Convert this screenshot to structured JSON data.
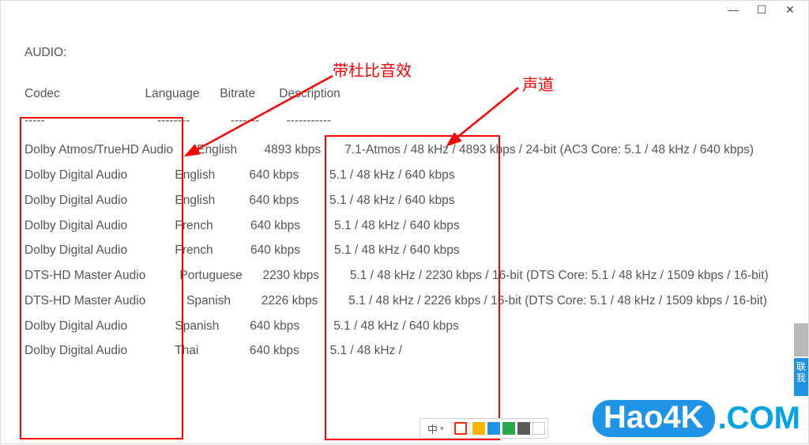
{
  "window": {
    "min_icon": "—",
    "max_icon": "☐",
    "close_icon": "✕"
  },
  "section_title": "AUDIO:",
  "headers": {
    "codec": "Codec",
    "language": "Language",
    "bitrate": "Bitrate",
    "description": "Description"
  },
  "dashes": {
    "codec": "-----",
    "language": "--------",
    "bitrate": "-------",
    "description": "-----------"
  },
  "rows": [
    {
      "codec": "Dolby Atmos/TrueHD Audio",
      "language": "English",
      "bitrate": "4893 kbps",
      "description": "7.1-Atmos / 48 kHz / 4893 kbps / 24-bit (AC3 Core: 5.1 / 48 kHz / 640 kbps)"
    },
    {
      "codec": "Dolby Digital Audio",
      "language": "English",
      "bitrate": "640 kbps",
      "description": "5.1 / 48 kHz / 640 kbps"
    },
    {
      "codec": "Dolby Digital Audio",
      "language": "English",
      "bitrate": "640 kbps",
      "description": "5.1 / 48 kHz / 640 kbps"
    },
    {
      "codec": "Dolby Digital Audio",
      "language": "French",
      "bitrate": "640 kbps",
      "description": "5.1 / 48 kHz / 640 kbps"
    },
    {
      "codec": "Dolby Digital Audio",
      "language": "French",
      "bitrate": "640 kbps",
      "description": "5.1 / 48 kHz / 640 kbps"
    },
    {
      "codec": "DTS-HD Master Audio",
      "language": "Portuguese",
      "bitrate": "2230 kbps",
      "description": "5.1 / 48 kHz / 2230 kbps / 16-bit (DTS Core: 5.1 / 48 kHz / 1509 kbps / 16-bit)"
    },
    {
      "codec": "DTS-HD Master Audio",
      "language": "Spanish",
      "bitrate": "2226 kbps",
      "description": "5.1 / 48 kHz / 2226 kbps / 16-bit (DTS Core: 5.1 / 48 kHz / 1509 kbps / 16-bit)"
    },
    {
      "codec": "Dolby Digital Audio",
      "language": "Spanish",
      "bitrate": "640 kbps",
      "description": "5.1 / 48 kHz / 640 kbps"
    },
    {
      "codec": "Dolby Digital Audio",
      "language": "Thai",
      "bitrate": "640 kbps",
      "description": "5.1 / 48 kHz /"
    }
  ],
  "annotations": {
    "dolby_label": "带杜比音效",
    "channel_label": "声道"
  },
  "ime": {
    "mode": "中",
    "caret": "▾"
  },
  "side": {
    "chat": "联我"
  },
  "logo": {
    "pill": "Hao4K",
    "rest": ".COM"
  }
}
